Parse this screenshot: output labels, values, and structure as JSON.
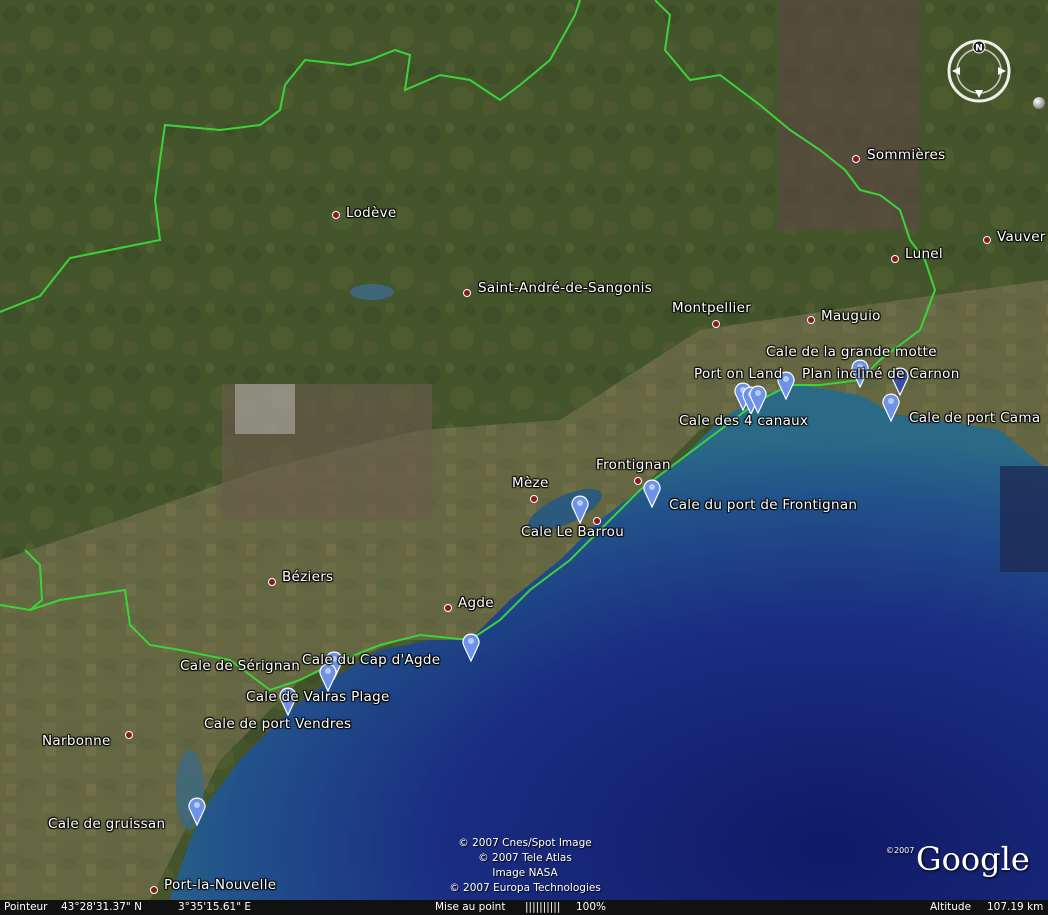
{
  "map": {
    "cities": [
      {
        "name": "Lodève"
      },
      {
        "name": "Saint-André-de-Sangonis"
      },
      {
        "name": "Montpellier"
      },
      {
        "name": "Mauguio"
      },
      {
        "name": "Lunel"
      },
      {
        "name": "Sommières"
      },
      {
        "name": "Vauver"
      },
      {
        "name": "Frontignan"
      },
      {
        "name": "Mèze"
      },
      {
        "name": "Béziers"
      },
      {
        "name": "Agde"
      },
      {
        "name": "Narbonne"
      },
      {
        "name": "Port-la-Nouvelle"
      }
    ],
    "placemarks": [
      {
        "name": "Cale de la grande motte"
      },
      {
        "name": "Port on Land"
      },
      {
        "name": "Plan incliné de Carnon"
      },
      {
        "name": "Cale des 4 canaux"
      },
      {
        "name": "Cale de port Cama"
      },
      {
        "name": "Cale du port de Frontignan"
      },
      {
        "name": "Cale Le Barrou"
      },
      {
        "name": "Cale de Sérignan"
      },
      {
        "name": "Cale du Cap d'Agde"
      },
      {
        "name": "Cale de Valras Plage"
      },
      {
        "name": "Cale de port Vendres"
      },
      {
        "name": "Cale de gruissan"
      }
    ]
  },
  "credits": {
    "line1": "© 2007 Cnes/Spot Image",
    "line2": "© 2007 Tele Atlas",
    "line3": "Image NASA",
    "line4": "© 2007 Europa Technologies"
  },
  "logo": {
    "text": "Google",
    "year": "©2007"
  },
  "status": {
    "pointer_label": "Pointeur",
    "lat": "43°28'31.37\" N",
    "lon": "3°35'15.61\" E",
    "focus_label": "Mise au point",
    "focus_bar": "||||||||||",
    "focus_value": "100%",
    "altitude_label": "Altitude",
    "altitude_value": "107.19 km"
  },
  "compass": {
    "north_letter": "N"
  }
}
